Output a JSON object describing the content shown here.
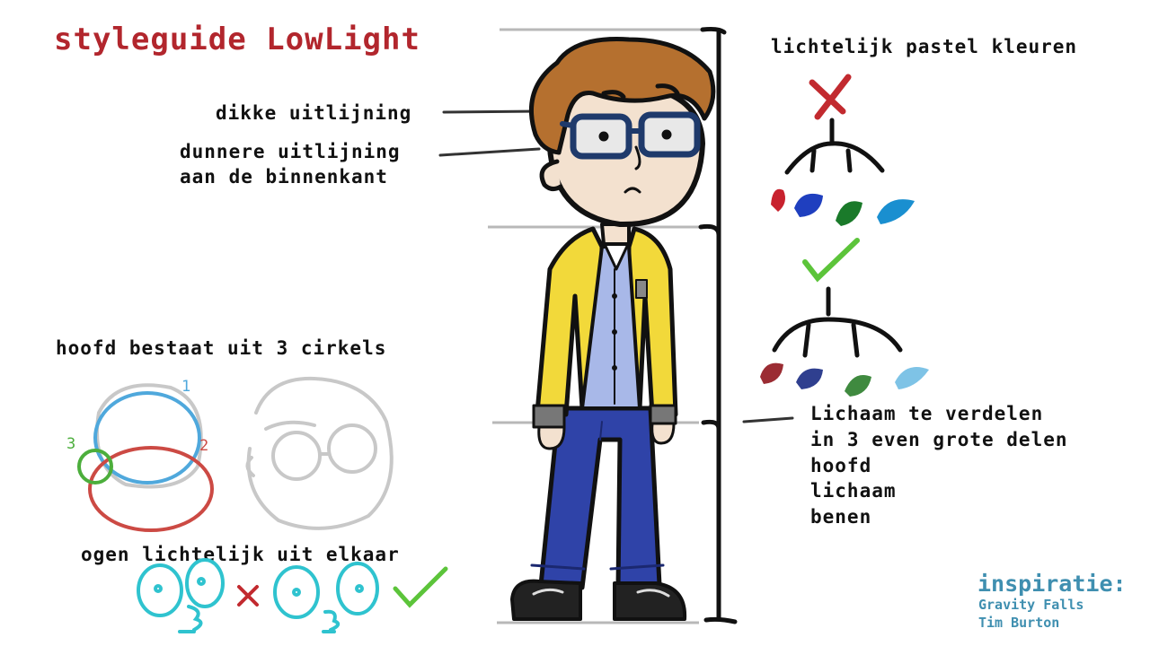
{
  "title": "styleguide LowLight",
  "labels": {
    "thick_outline": "dikke uitlijning",
    "thin_outline_line1": "dunnere uitlijning",
    "thin_outline_line2": "aan de binnenkant",
    "pastel": "lichtelijk pastel kleuren",
    "head_circles": "hoofd bestaat uit 3 cirkels",
    "eyes_apart": "ogen lichtelijk uit elkaar",
    "body_division": [
      "Lichaam te verdelen",
      "in 3 even grote delen",
      "hoofd",
      "lichaam",
      "benen"
    ]
  },
  "circle_numbers": [
    "1",
    "2",
    "3"
  ],
  "inspiration": {
    "heading": "inspiratie:",
    "items": [
      "Gravity Falls",
      "Tim Burton"
    ]
  },
  "colors": {
    "title_red": "#b2262d",
    "inspiration_blue": "#3f8fb0",
    "swatches_bright": [
      "#c8222e",
      "#1f3fbf",
      "#1a7a2a",
      "#1a8fd0"
    ],
    "swatches_pastel": [
      "#9b2c33",
      "#2f3f8f",
      "#3f8a3f",
      "#7ec3e6"
    ],
    "check_green": "#5cc43a",
    "cross_red": "#c22a2f",
    "eye_cyan": "#2fc3cf"
  }
}
